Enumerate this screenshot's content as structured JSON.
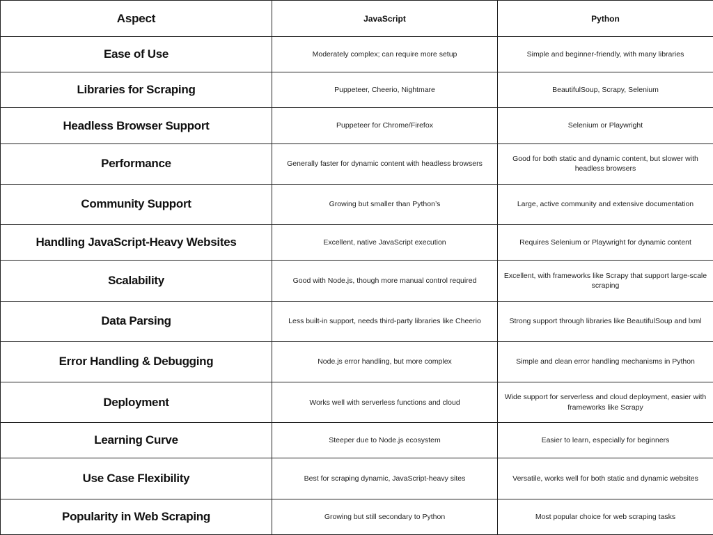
{
  "table": {
    "headers": [
      "Aspect",
      "JavaScript",
      "Python"
    ],
    "rows": [
      {
        "aspect": "Ease of Use",
        "javascript": "Moderately complex; can require more setup",
        "python": "Simple and beginner-friendly, with many libraries"
      },
      {
        "aspect": "Libraries for Scraping",
        "javascript": "Puppeteer, Cheerio, Nightmare",
        "python": "BeautifulSoup, Scrapy, Selenium"
      },
      {
        "aspect": "Headless Browser Support",
        "javascript": "Puppeteer for Chrome/Firefox",
        "python": "Selenium or Playwright"
      },
      {
        "aspect": "Performance",
        "javascript": "Generally faster for dynamic content with headless browsers",
        "python": "Good for both static and dynamic content, but slower with headless browsers"
      },
      {
        "aspect": "Community Support",
        "javascript": "Growing but smaller than Python’s",
        "python": "Large, active community and extensive documentation"
      },
      {
        "aspect": "Handling JavaScript-Heavy Websites",
        "javascript": "Excellent, native JavaScript execution",
        "python": "Requires Selenium or Playwright for dynamic content"
      },
      {
        "aspect": "Scalability",
        "javascript": "Good with Node.js, though more manual control required",
        "python": "Excellent, with frameworks like Scrapy that support large-scale scraping"
      },
      {
        "aspect": "Data Parsing",
        "javascript": "Less built-in support, needs third-party libraries like Cheerio",
        "python": "Strong support through libraries like BeautifulSoup and lxml"
      },
      {
        "aspect": "Error Handling & Debugging",
        "javascript": "Node.js error handling, but more complex",
        "python": "Simple and clean error handling mechanisms in Python"
      },
      {
        "aspect": "Deployment",
        "javascript": "Works well with serverless functions and cloud",
        "python": "Wide support for serverless and cloud deployment, easier with frameworks like Scrapy"
      },
      {
        "aspect": "Learning Curve",
        "javascript": "Steeper due to Node.js ecosystem",
        "python": "Easier to learn, especially for beginners"
      },
      {
        "aspect": "Use Case Flexibility",
        "javascript": "Best for scraping dynamic, JavaScript-heavy sites",
        "python": "Versatile, works well for both static and dynamic websites"
      },
      {
        "aspect": "Popularity in Web Scraping",
        "javascript": "Growing but still secondary to Python",
        "python": "Most popular choice for web scraping tasks"
      }
    ]
  }
}
